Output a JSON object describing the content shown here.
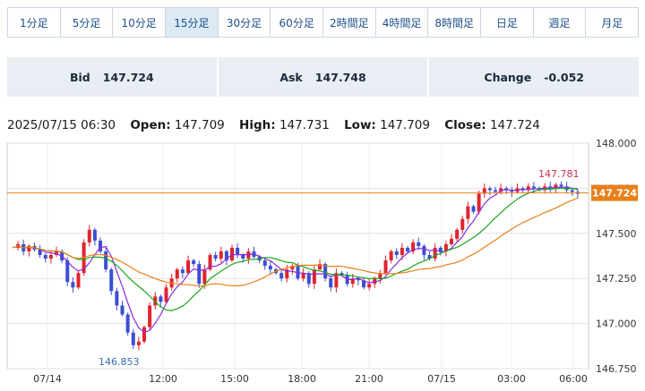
{
  "timeframes": [
    {
      "label": "1分足",
      "active": false
    },
    {
      "label": "5分足",
      "active": false
    },
    {
      "label": "10分足",
      "active": false
    },
    {
      "label": "15分足",
      "active": true
    },
    {
      "label": "30分足",
      "active": false
    },
    {
      "label": "60分足",
      "active": false
    },
    {
      "label": "2時間足",
      "active": false
    },
    {
      "label": "4時間足",
      "active": false
    },
    {
      "label": "8時間足",
      "active": false
    },
    {
      "label": "日足",
      "active": false
    },
    {
      "label": "週足",
      "active": false
    },
    {
      "label": "月足",
      "active": false
    }
  ],
  "quote": {
    "bid_label": "Bid",
    "bid": "147.724",
    "ask_label": "Ask",
    "ask": "147.748",
    "change_label": "Change",
    "change": "-0.052"
  },
  "ohlc": {
    "datetime": "2025/07/15 06:30",
    "open_label": "Open:",
    "open": "147.709",
    "high_label": "High:",
    "high": "147.731",
    "low_label": "Low:",
    "low": "147.709",
    "close_label": "Close:",
    "close": "147.724"
  },
  "colors": {
    "up": "#e0242e",
    "down": "#3b4fd0",
    "ma_short": "#8a2be2",
    "ma_mid": "#1aa61a",
    "ma_long": "#e8801a",
    "price_line": "#e8801a"
  },
  "chart_data": {
    "type": "candlestick",
    "ylim": [
      146.75,
      148.0
    ],
    "y_ticks": [
      "148.000",
      "147.750",
      "147.500",
      "147.250",
      "147.000",
      "146.750"
    ],
    "x_ticks": [
      "07/14",
      "12:00",
      "15:00",
      "18:00",
      "21:00",
      "07/15",
      "03:00",
      "06:00"
    ],
    "current_price": "147.724",
    "high_annotation": "147.781",
    "low_annotation": "146.853",
    "close_series": [
      147.42,
      147.44,
      147.4,
      147.43,
      147.41,
      147.38,
      147.36,
      147.38,
      147.4,
      147.35,
      147.23,
      147.2,
      147.28,
      147.45,
      147.52,
      147.46,
      147.4,
      147.3,
      147.18,
      147.1,
      147.05,
      146.95,
      146.88,
      146.9,
      146.98,
      147.1,
      147.15,
      147.12,
      147.2,
      147.25,
      147.3,
      147.28,
      147.35,
      147.33,
      147.22,
      147.3,
      147.38,
      147.36,
      147.4,
      147.35,
      147.42,
      147.38,
      147.36,
      147.4,
      147.37,
      147.35,
      147.32,
      147.3,
      147.28,
      147.25,
      147.3,
      147.32,
      147.25,
      147.28,
      147.22,
      147.3,
      147.33,
      147.25,
      147.2,
      147.28,
      147.27,
      147.22,
      147.25,
      147.24,
      147.2,
      147.22,
      147.25,
      147.28,
      147.35,
      147.4,
      147.38,
      147.42,
      147.4,
      147.45,
      147.43,
      147.38,
      147.36,
      147.42,
      147.4,
      147.44,
      147.47,
      147.52,
      147.58,
      147.65,
      147.62,
      147.72,
      147.75,
      147.74,
      147.73,
      147.75,
      147.74,
      147.73,
      147.75,
      147.74,
      147.76,
      147.75,
      147.74,
      147.76,
      147.75,
      147.77,
      147.76,
      147.74,
      147.73,
      147.72
    ]
  }
}
